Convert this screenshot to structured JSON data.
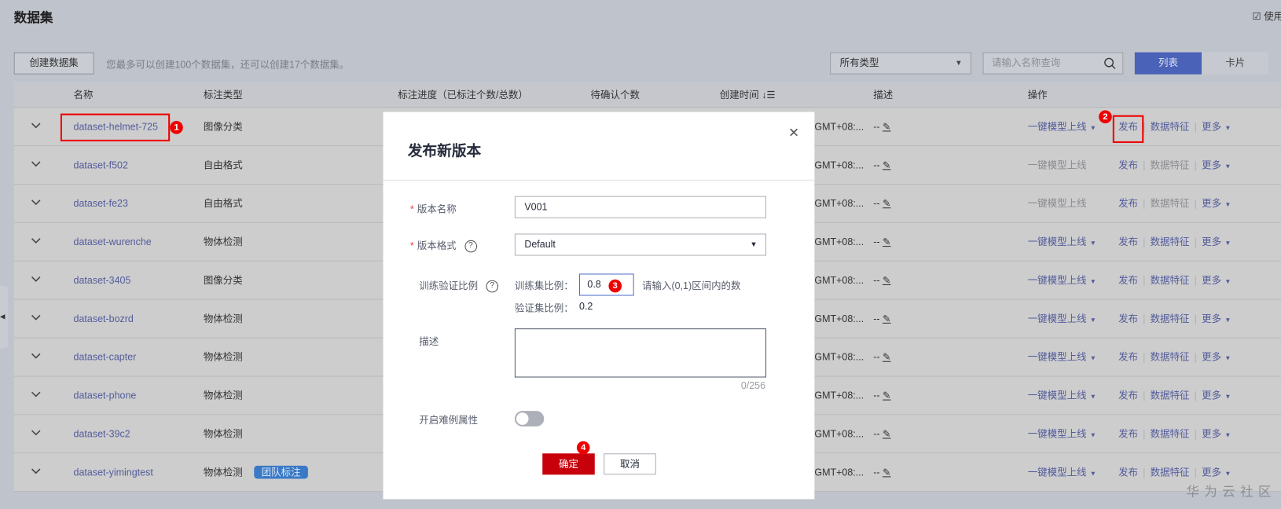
{
  "page": {
    "title": "数据集",
    "usage_link": "使用"
  },
  "toolbar": {
    "create_label": "创建数据集",
    "hint": "您最多可以创建100个数据集，还可以创建17个数据集。",
    "type_filter": "所有类型",
    "search_placeholder": "请输入名称查询",
    "view_list": "列表",
    "view_card": "卡片"
  },
  "table": {
    "headers": {
      "name": "名称",
      "type": "标注类型",
      "progress": "标注进度（已标注个数/总数）",
      "pending": "待确认个数",
      "created": "创建时间",
      "desc": "描述",
      "ops": "操作"
    },
    "rows": [
      {
        "name": "dataset-helmet-725",
        "type": "图像分类",
        "created": "GMT+08:...",
        "desc": "--",
        "deploy": "一键模型上线",
        "deploy_enabled": true,
        "features_enabled": true
      },
      {
        "name": "dataset-f502",
        "type": "自由格式",
        "created": "GMT+08:...",
        "desc": "--",
        "deploy": "一键模型上线",
        "deploy_enabled": false,
        "features_enabled": false
      },
      {
        "name": "dataset-fe23",
        "type": "自由格式",
        "created": "GMT+08:...",
        "desc": "--",
        "deploy": "一键模型上线",
        "deploy_enabled": false,
        "features_enabled": false
      },
      {
        "name": "dataset-wurenche",
        "type": "物体检测",
        "created": "GMT+08:...",
        "desc": "--",
        "deploy": "一键模型上线",
        "deploy_enabled": true,
        "features_enabled": true
      },
      {
        "name": "dataset-3405",
        "type": "图像分类",
        "created": "GMT+08:...",
        "desc": "--",
        "deploy": "一键模型上线",
        "deploy_enabled": true,
        "features_enabled": true
      },
      {
        "name": "dataset-bozrd",
        "type": "物体检测",
        "created": "GMT+08:...",
        "desc": "--",
        "deploy": "一键模型上线",
        "deploy_enabled": true,
        "features_enabled": true
      },
      {
        "name": "dataset-capter",
        "type": "物体检测",
        "created": "GMT+08:...",
        "desc": "--",
        "deploy": "一键模型上线",
        "deploy_enabled": true,
        "features_enabled": true
      },
      {
        "name": "dataset-phone",
        "type": "物体检测",
        "created": "GMT+08:...",
        "desc": "--",
        "deploy": "一键模型上线",
        "deploy_enabled": true,
        "features_enabled": true
      },
      {
        "name": "dataset-39c2",
        "type": "物体检测",
        "created": "GMT+08:...",
        "desc": "--",
        "deploy": "一键模型上线",
        "deploy_enabled": true,
        "features_enabled": true
      },
      {
        "name": "dataset-yimingtest",
        "type": "物体检测",
        "tag": "团队标注",
        "created": "GMT+08:...",
        "desc": "--",
        "deploy": "一键模型上线",
        "deploy_enabled": true,
        "features_enabled": true
      }
    ],
    "action_publish": "发布",
    "action_features": "数据特征",
    "action_more": "更多"
  },
  "modal": {
    "title": "发布新版本",
    "version_name_label": "版本名称",
    "version_name_value": "V001",
    "version_format_label": "版本格式",
    "version_format_value": "Default",
    "split_label": "训练验证比例",
    "train_label": "训练集比例：",
    "train_value": "0.8",
    "train_hint": "请输入(0,1)区间内的数",
    "val_label": "验证集比例：",
    "val_value": "0.2",
    "desc_label": "描述",
    "desc_counter": "0/256",
    "hard_example_label": "开启难例属性",
    "hard_example_on": false,
    "ok_label": "确定",
    "cancel_label": "取消"
  },
  "annotations": [
    "1",
    "2",
    "3",
    "4"
  ],
  "watermark": "华为云社区",
  "colors": {
    "primary": "#c7000b",
    "link": "#526ecc",
    "annotation": "#e00000"
  }
}
